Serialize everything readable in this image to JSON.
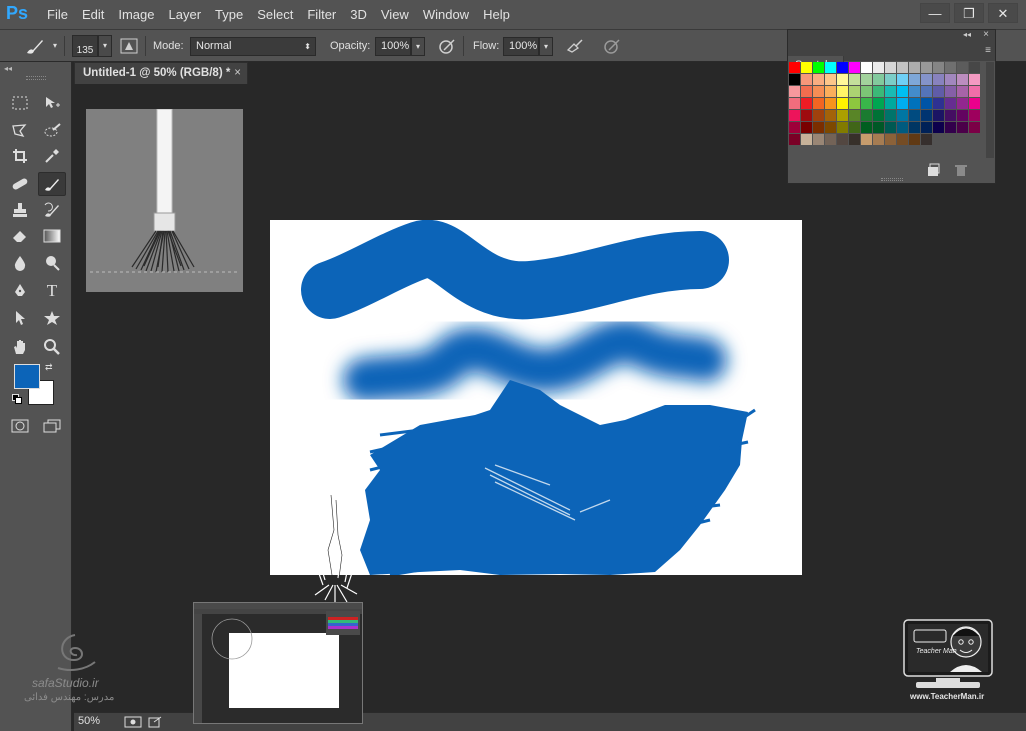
{
  "app": {
    "logo": "Ps"
  },
  "menu": [
    "File",
    "Edit",
    "Image",
    "Layer",
    "Type",
    "Select",
    "Filter",
    "3D",
    "View",
    "Window",
    "Help"
  ],
  "window_controls": {
    "minimize": "—",
    "restore": "❐",
    "close": "✕"
  },
  "options": {
    "brush_size": "135",
    "mode_label": "Mode:",
    "mode_value": "Normal",
    "opacity_label": "Opacity:",
    "opacity_value": "100%",
    "flow_label": "Flow:",
    "flow_value": "100%"
  },
  "document": {
    "tab_title": "Untitled-1 @ 50% (RGB/8) *",
    "tab_close": "×",
    "zoom": "50%"
  },
  "tools": {
    "fg_color": "#0c64b8",
    "bg_color": "#ffffff",
    "type_tool_label": "T"
  },
  "swatches": {
    "title": "Swatches",
    "colors": [
      "#ff0000",
      "#ffff00",
      "#00ff00",
      "#00ffff",
      "#0000ff",
      "#ff00ff",
      "#ffffff",
      "#ebebeb",
      "#d6d6d6",
      "#c2c2c2",
      "#adadad",
      "#999999",
      "#858585",
      "#707070",
      "#5c5c5c",
      "#474747",
      "#000000",
      "#f7977a",
      "#f9ad81",
      "#fdc68a",
      "#fff79a",
      "#c4df9b",
      "#a2d39c",
      "#82ca9d",
      "#7bcdc8",
      "#6ecff6",
      "#7ea7d8",
      "#8493ca",
      "#8882be",
      "#a187be",
      "#bc8dbf",
      "#f49ac2",
      "#f6989d",
      "#f26c4f",
      "#f68e55",
      "#fbaf5c",
      "#fff467",
      "#acd372",
      "#7cc576",
      "#3bb878",
      "#1abbb4",
      "#00bff3",
      "#438ccb",
      "#5574b9",
      "#605ca8",
      "#855fa8",
      "#a763a8",
      "#f06ea9",
      "#f26d7d",
      "#ed1c24",
      "#f26522",
      "#f7941d",
      "#fff200",
      "#8dc73f",
      "#39b54a",
      "#00a651",
      "#00a99d",
      "#00aeef",
      "#0072bc",
      "#0054a6",
      "#2e3192",
      "#662d91",
      "#92278f",
      "#ec008c",
      "#ed145b",
      "#9e0b0f",
      "#a0410d",
      "#a36209",
      "#aba000",
      "#598527",
      "#1a7b30",
      "#007236",
      "#00746b",
      "#0076a3",
      "#004b80",
      "#003471",
      "#1b1464",
      "#440e62",
      "#630460",
      "#9e005d",
      "#9e0039",
      "#790000",
      "#7b2e00",
      "#7d4900",
      "#827b00",
      "#406618",
      "#005e20",
      "#005826",
      "#005952",
      "#005b7f",
      "#003663",
      "#002157",
      "#0d004c",
      "#32004b",
      "#4b0049",
      "#7b0046",
      "#7a0026",
      "#c7b299",
      "#998675",
      "#736357",
      "#534741",
      "#37302a",
      "#c69c6d",
      "#a67c52",
      "#8c6239",
      "#754c24",
      "#603913",
      "#362f2d"
    ]
  },
  "watermarks": {
    "left_site": "safaStudio.ir",
    "left_teacher": "مدرس: مهندس فدائی",
    "right_brand": "Teacher Man",
    "right_site": "www.TeacherMan.ir"
  }
}
